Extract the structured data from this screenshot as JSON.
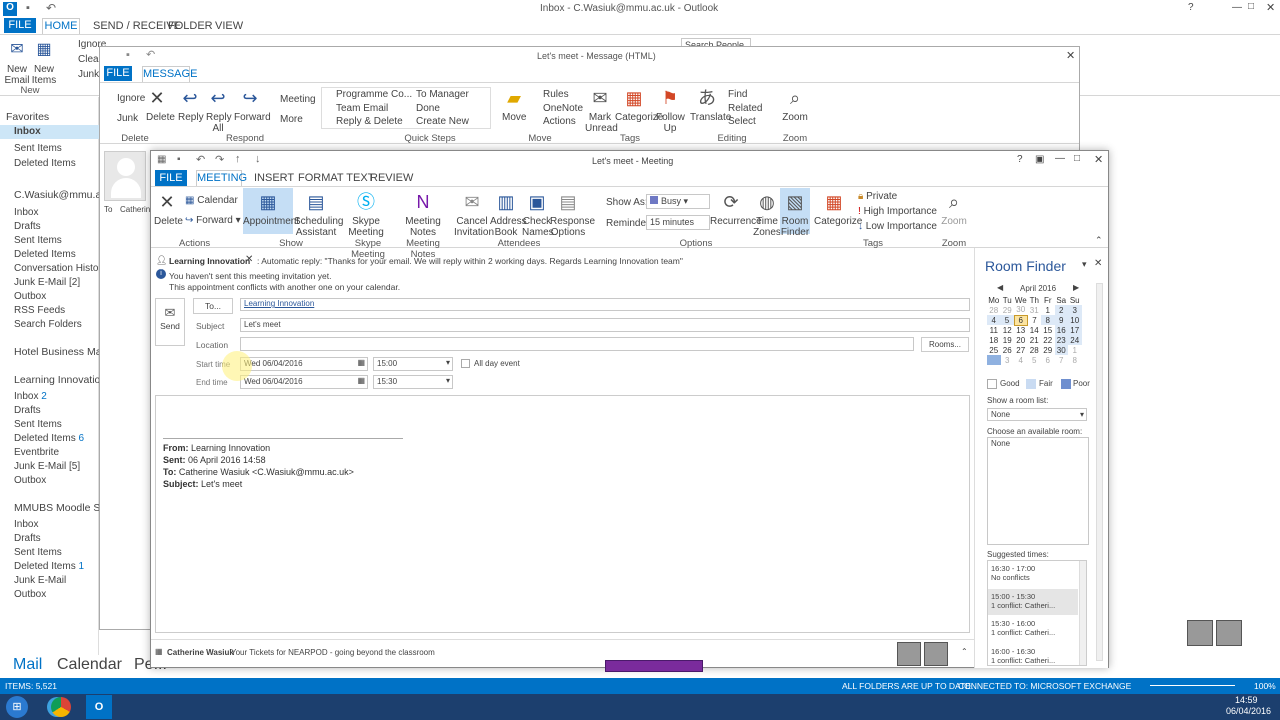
{
  "main_title": "Inbox - C.Wasiuk@mmu.ac.uk - Outlook",
  "main_tabs": [
    "FILE",
    "HOME",
    "SEND / RECEIVE",
    "FOLDER",
    "VIEW"
  ],
  "home_new": [
    "New Email",
    "New Items"
  ],
  "home_new_group": "New",
  "home_delete_btns": [
    "Ignore",
    "Clean Up",
    "Junk"
  ],
  "search_people": "Search People",
  "bg_quick": [
    "Programme Co...",
    "To Manager"
  ],
  "nav": {
    "favorites_label": "Favorites",
    "favorites": [
      "Inbox",
      "Sent Items",
      "Deleted Items"
    ],
    "account": "C.Wasiuk@mmu.ac.uk",
    "account_items": [
      "Inbox",
      "Drafts",
      "Sent Items",
      "Deleted Items",
      "Conversation History",
      "Junk E-Mail [2]",
      "Outbox",
      "RSS Feeds",
      "Search Folders"
    ],
    "hotel": "Hotel Business Manag",
    "li_label": "Learning Innovation",
    "li_items": [
      "Inbox",
      "Drafts",
      "Sent Items",
      "Deleted Items",
      "Eventbrite",
      "Junk E-Mail [5]",
      "Outbox"
    ],
    "li_counts": [
      "2",
      "",
      "",
      "6",
      "",
      "",
      ""
    ],
    "mm_label": "MMUBS Moodle Staff",
    "mm_items": [
      "Inbox",
      "Drafts",
      "Sent Items",
      "Deleted Items",
      "Junk E-Mail",
      "Outbox"
    ],
    "mm_counts": [
      "",
      "",
      "",
      "1",
      "",
      ""
    ]
  },
  "bottom_nav": [
    "Mail",
    "Calendar",
    "Pe..."
  ],
  "status": {
    "items": "ITEMS: 5,521",
    "folders": "ALL FOLDERS ARE UP TO DATE.",
    "connected": "CONNECTED TO: MICROSOFT EXCHANGE",
    "zoom": "100%"
  },
  "taskbar": {
    "time": "14:59",
    "date": "06/04/2016"
  },
  "message_window": {
    "title": "Let's meet - Message (HTML)",
    "tabs": [
      "FILE",
      "MESSAGE"
    ],
    "delete_group": {
      "label": "Delete",
      "buttons": [
        "Ignore",
        "Junk",
        "Delete"
      ]
    },
    "respond_group": {
      "label": "Respond",
      "buttons": [
        "Reply",
        "Reply All",
        "Forward",
        "Meeting",
        "More"
      ]
    },
    "quicksteps_group": {
      "label": "Quick Steps",
      "items": [
        "Programme Co...",
        "Team Email",
        "Reply & Delete",
        "To Manager",
        "Done",
        "Create New"
      ]
    },
    "move_group": {
      "label": "Move",
      "buttons": [
        "Move",
        "Rules",
        "OneNote",
        "Actions"
      ]
    },
    "tags_group": {
      "label": "Tags",
      "buttons": [
        "Mark Unread",
        "Categorize",
        "Follow Up"
      ]
    },
    "editing_group": {
      "label": "Editing",
      "buttons": [
        "Translate",
        "Find",
        "Related",
        "Select"
      ]
    },
    "zoom_group": {
      "label": "Zoom",
      "buttons": [
        "Zoom"
      ]
    },
    "to_label": "To",
    "to_name": "Catherine"
  },
  "meeting_window": {
    "title": "Let's meet - Meeting",
    "tabs": [
      "FILE",
      "MEETING",
      "INSERT",
      "FORMAT TEXT",
      "REVIEW"
    ],
    "actions": {
      "label": "Actions",
      "delete": "Delete",
      "calendar": "Calendar",
      "forward": "Forward"
    },
    "show": {
      "label": "Show",
      "appointment": "Appointment",
      "scheduling": "Scheduling Assistant"
    },
    "skype": {
      "label": "Skype Meeting",
      "btn": "Skype Meeting"
    },
    "notes": {
      "label": "Meeting Notes",
      "btn": "Meeting Notes"
    },
    "attendees": {
      "label": "Attendees",
      "cancel": "Cancel Invitation",
      "address": "Address Book",
      "check": "Check Names",
      "response": "Response Options"
    },
    "options": {
      "label": "Options",
      "show_as": "Show As:",
      "show_as_val": "Busy",
      "reminder": "Reminder:",
      "reminder_val": "15 minutes",
      "recurrence": "Recurrence",
      "time_zones": "Time Zones",
      "room_finder": "Room Finder"
    },
    "tags": {
      "label": "Tags",
      "categorize": "Categorize",
      "private": "Private",
      "high": "High Importance",
      "low": "Low Importance"
    },
    "zoom": {
      "label": "Zoom",
      "btn": "Zoom"
    },
    "info_sender": "Learning Innovation",
    "info_reply": ": Automatic reply: \"Thanks for your email. We will reply within 2 working days.   Regards  Learning Innovation team\"",
    "info_notsent": "You haven't sent this meeting invitation yet.",
    "info_conflict": "This appointment conflicts with another one on your calendar.",
    "send": "Send",
    "to_btn": "To...",
    "to_val": "Learning Innovation",
    "subject_label": "Subject",
    "subject_val": "Let's meet",
    "location_label": "Location",
    "rooms_btn": "Rooms...",
    "start_label": "Start time",
    "start_date": "Wed 06/04/2016",
    "start_time": "15:00",
    "end_label": "End time",
    "end_date": "Wed 06/04/2016",
    "end_time": "15:30",
    "allday": "All day event",
    "body": {
      "from_l": "From:",
      "from": "Learning Innovation",
      "sent_l": "Sent:",
      "sent": "06 April 2016 14:58",
      "to_l": "To:",
      "to": "Catherine Wasiuk <C.Wasiuk@mmu.ac.uk>",
      "subj_l": "Subject:",
      "subj": "Let's meet"
    },
    "people_name": "Catherine Wasiuk",
    "people_text": "Your Tickets for NEARPOD - going beyond the classroom"
  },
  "room_finder": {
    "title": "Room Finder",
    "month": "April 2016",
    "days": [
      "Mo",
      "Tu",
      "We",
      "Th",
      "Fr",
      "Sa",
      "Su"
    ],
    "weeks": [
      [
        "28",
        "29",
        "30",
        "31",
        "1",
        "2",
        "3"
      ],
      [
        "4",
        "5",
        "6",
        "7",
        "8",
        "9",
        "10"
      ],
      [
        "11",
        "12",
        "13",
        "14",
        "15",
        "16",
        "17"
      ],
      [
        "18",
        "19",
        "20",
        "21",
        "22",
        "23",
        "24"
      ],
      [
        "25",
        "26",
        "27",
        "28",
        "29",
        "30",
        "1"
      ],
      [
        "2",
        "3",
        "4",
        "5",
        "6",
        "7",
        "8"
      ]
    ],
    "legend": [
      "Good",
      "Fair",
      "Poor"
    ],
    "room_list_label": "Show a room list:",
    "room_list_val": "None",
    "available_label": "Choose an available room:",
    "available_val": "None",
    "suggested_label": "Suggested times:",
    "suggestions": [
      [
        "16:30 - 17:00",
        "No conflicts"
      ],
      [
        "15:00 - 15:30",
        "1 conflict: Catheri..."
      ],
      [
        "15:30 - 16:00",
        "1 conflict: Catheri..."
      ],
      [
        "16:00 - 16:30",
        "1 conflict: Catheri..."
      ]
    ]
  },
  "colors": {
    "accent": "#0072c6",
    "selected": "#cde6f7",
    "busy": "#6f79c4",
    "sel_day": "#fce4a0"
  }
}
